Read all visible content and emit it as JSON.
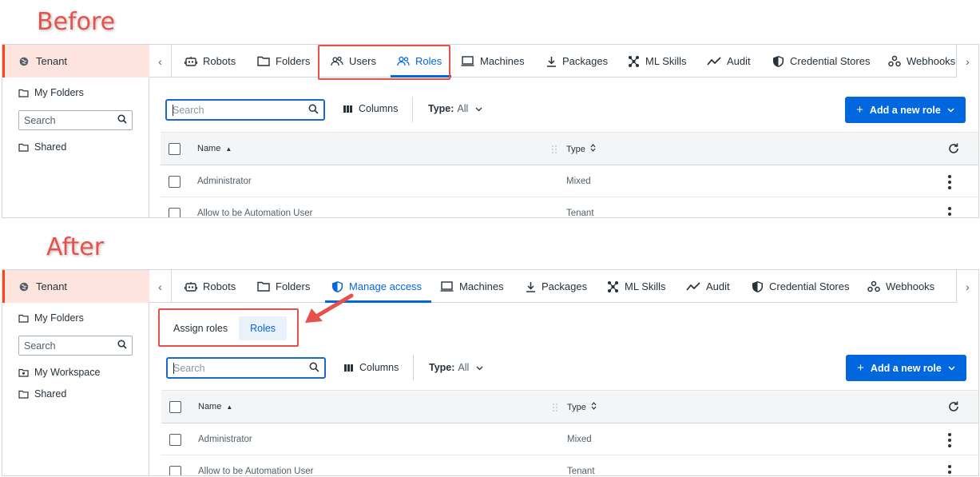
{
  "captions": {
    "before": "Before",
    "after": "After"
  },
  "sidebar": {
    "tenant": "Tenant",
    "my_folders": "My Folders",
    "search_placeholder": "Search",
    "my_workspace": "My Workspace",
    "shared": "Shared"
  },
  "before": {
    "tabs": [
      "Robots",
      "Folders",
      "Users",
      "Roles",
      "Machines",
      "Packages",
      "ML Skills",
      "Audit",
      "Credential Stores",
      "Webhooks"
    ],
    "active_tab": "Roles"
  },
  "after": {
    "tabs": [
      "Robots",
      "Folders",
      "Manage access",
      "Machines",
      "Packages",
      "ML Skills",
      "Audit",
      "Credential Stores",
      "Webhooks"
    ],
    "active_tab": "Manage access",
    "subtabs": [
      "Assign roles",
      "Roles"
    ],
    "active_subtab": "Roles"
  },
  "toolbar": {
    "search_placeholder": "Search",
    "columns_label": "Columns",
    "type_label": "Type:",
    "type_value": "All",
    "add_button": "Add a new role"
  },
  "table": {
    "columns": [
      "Name",
      "Type"
    ],
    "rows": [
      {
        "name": "Administrator",
        "type": "Mixed"
      },
      {
        "name": "Allow to be Automation User",
        "type": "Tenant"
      }
    ]
  },
  "colors": {
    "accent": "#0067df",
    "highlight": "#e8504a",
    "tenant_bg": "#fde4df"
  }
}
